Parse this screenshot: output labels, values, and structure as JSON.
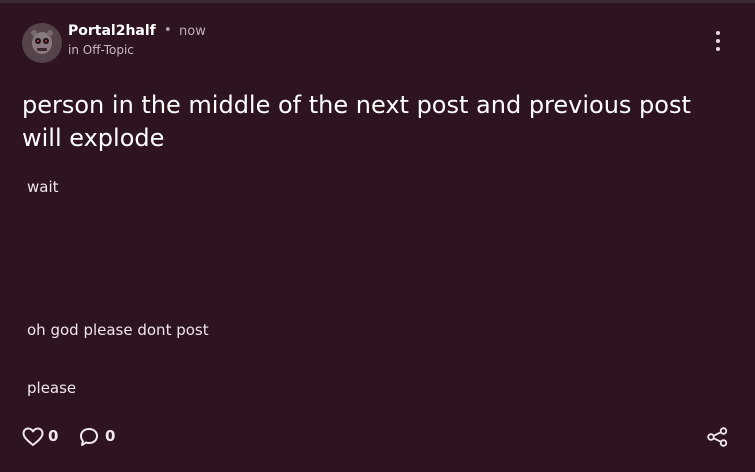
{
  "post": {
    "author": "Portal2half",
    "separator": "•",
    "time": "now",
    "community": "in Off-Topic",
    "title": "person in the middle of the next post and previous post will explode",
    "body_lines": [
      "wait",
      "oh god please dont post",
      "please"
    ],
    "likes": "0",
    "comments": "0"
  },
  "icons": {
    "avatar": "avatar-character",
    "menu": "kebab-menu-icon",
    "like": "heart-icon",
    "comment": "comment-bubble-icon",
    "share": "share-icon"
  },
  "colors": {
    "background": "#2e1321",
    "text": "#ffffff",
    "muted": "#c9b9c1"
  }
}
